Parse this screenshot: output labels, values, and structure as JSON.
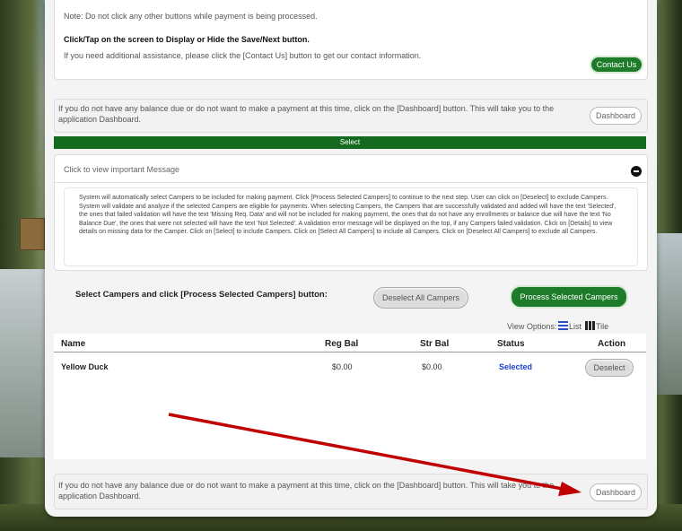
{
  "top_note": {
    "line1": "Note: Do not click any other buttons while payment is being processed.",
    "line2": "Click/Tap on the screen to Display or Hide the Save/Next button.",
    "line3": "If you need additional assistance, please click the [Contact Us] button to get our contact information.",
    "contact_label": "Contact Us"
  },
  "dashboard_note": {
    "text": "If you do not have any balance due or do not want to make a payment at this time, click on the [Dashboard] button. This will take you to the application Dashboard.",
    "button_label": "Dashboard"
  },
  "select_bar": {
    "label": "Select"
  },
  "message": {
    "header": "Click to view important Message",
    "body": "System will automatically select Campers to be included for making payment. Click [Process Selected Campers] to continue to the next step. User can click on [Deselect] to exclude Campers. System will validate and analyze if the selected Campers are eligible for payments. When selecting Campers, the Campers that are successfully validated and added will have the text 'Selected', the ones that failed validation will have the text 'Missing Req. Data' and will not be included for making payment, the ones that do not have any enrollments or balance due will have the text 'No Balance Due', the ones that were not selected will have the text 'Not Selected'. A validation error message will be displayed on the top, if any Campers failed validation. Click on [Details] to view details on missing data for the Camper. Click on [Select] to include Campers. Click on [Select All Campers] to include all Campers. Click on [Deselect All Campers] to exclude all Campers."
  },
  "campers": {
    "prompt": "Select Campers and click [Process Selected Campers] button:",
    "deselect_all_label": "Deselect All Campers",
    "process_label": "Process Selected Campers",
    "view_options_label": "View Options:",
    "list_label": "List",
    "tile_label": "Tile",
    "columns": {
      "name": "Name",
      "reg_bal": "Reg Bal",
      "str_bal": "Str Bal",
      "status": "Status",
      "action": "Action"
    },
    "rows": [
      {
        "name": "Yellow Duck",
        "reg_bal": "$0.00",
        "str_bal": "$0.00",
        "status": "Selected",
        "action": "Deselect"
      }
    ]
  },
  "bottom_note": {
    "text": "If you do not have any balance due or do not want to make a payment at this time, click on the [Dashboard] button. This will take you to the application Dashboard.",
    "button_label": "Dashboard"
  },
  "colors": {
    "accent_green": "#1e7b2a",
    "selected_status": "#1a3fd1",
    "arrow_red": "#c00000",
    "list_icon": "#2a4cc7"
  }
}
